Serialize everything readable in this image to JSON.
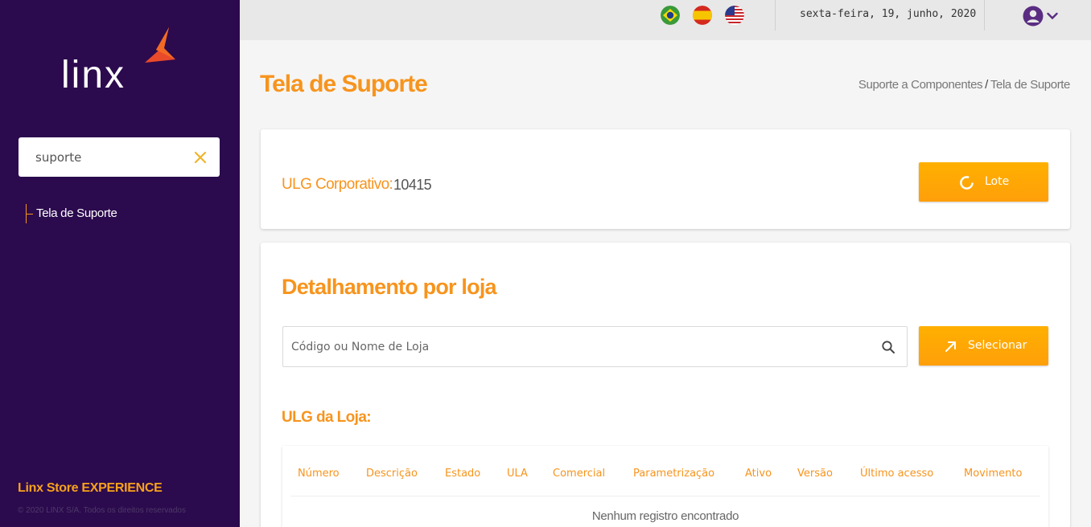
{
  "sidebar": {
    "logo_text": "linx",
    "search": {
      "value": "suporte",
      "placeholder": ""
    },
    "nav_items": [
      {
        "label": "Tela de Suporte"
      }
    ],
    "brand": "Linx Store EXPERIENCE",
    "copyright": "© 2020 LINX S/A. Todos os direitos reservados"
  },
  "topbar": {
    "languages": [
      "flag-brazil-icon",
      "flag-spain-icon",
      "flag-usa-icon"
    ],
    "date": "sexta-feira, 19, junho, 2020"
  },
  "header": {
    "title": "Tela de Suporte",
    "breadcrumb": {
      "parent": "Suporte a Componentes",
      "separator": "/",
      "current": "Tela de Suporte"
    }
  },
  "corporate": {
    "label": "ULG Corporativo:",
    "value": "10415",
    "lote_button": "Lote"
  },
  "details": {
    "title": "Detalhamento por loja",
    "search_placeholder": "Código ou Nome de Loja",
    "select_button": "Selecionar",
    "subtitle": "ULG da Loja:",
    "table": {
      "columns": [
        "Número",
        "Descrição",
        "Estado",
        "ULA",
        "Comercial",
        "Parametrização",
        "Ativo",
        "Versão",
        "Último acesso",
        "Movimento"
      ],
      "rows": [],
      "empty_message": "Nenhum registro encontrado"
    }
  },
  "colors": {
    "sidebar_bg": "#2c0a4e",
    "accent": "#f7941d",
    "button": "#ffa500"
  }
}
